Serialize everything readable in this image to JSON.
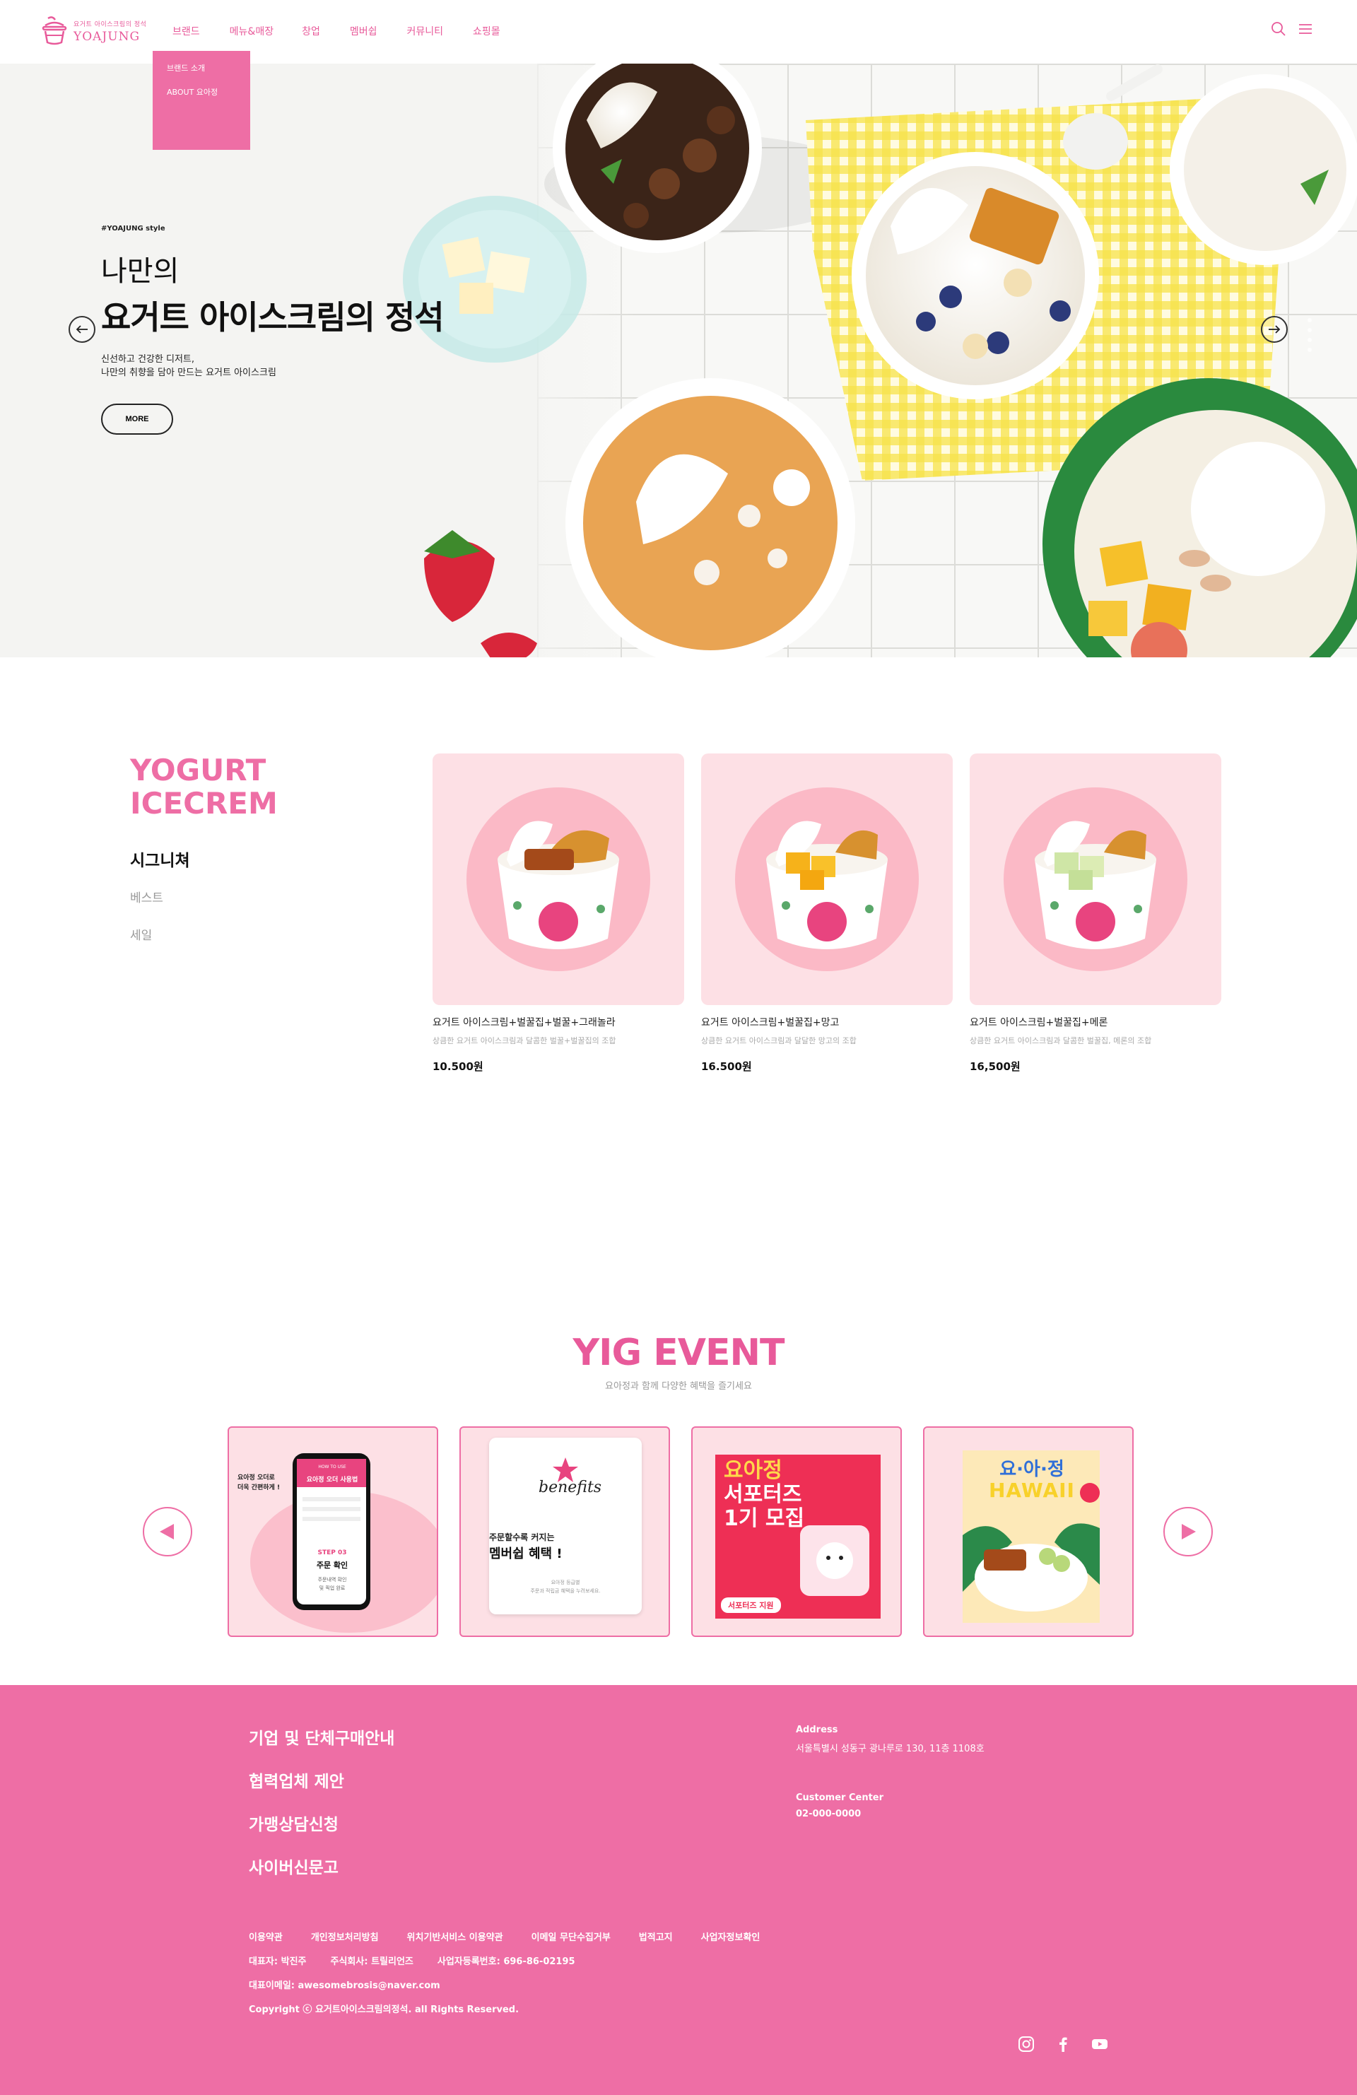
{
  "brand": {
    "tagline": "요거트 아이스크림의 정석",
    "name": "YOAJUNG",
    "accent_color": "#ee6ea5"
  },
  "nav": {
    "items": [
      "브랜드",
      "메뉴&매장",
      "창업",
      "멤버쉽",
      "커뮤니티",
      "쇼핑몰"
    ],
    "dropdown": [
      "브랜드 소개",
      "ABOUT 요아정"
    ]
  },
  "hero": {
    "tag": "#YOAJUNG style",
    "title_line1": "나만의",
    "title_line2": "요거트 아이스크림의 정석",
    "desc_line1": "신선하고 건강한 디저트,",
    "desc_line2": "나만의 취향을 담아 만드는 요거트 아이스크림",
    "more_label": "MORE",
    "prev_icon": "arrow-left-icon",
    "next_icon": "arrow-right-icon"
  },
  "yogurt": {
    "title_line1": "YOGURT",
    "title_line2": "ICECREM",
    "tabs": [
      "시그니쳐",
      "베스트",
      "세일"
    ],
    "products": [
      {
        "name": "요거트 아이스크림+벌꿀집+벌꿀+그래놀라",
        "desc": "상큼한 요거트 아이스크림과 달콤한 벌꿀+벌꿀집의 조합",
        "price": "10.500원"
      },
      {
        "name": "요거트 아이스크림+벌꿀집+망고",
        "desc": "상큼한 요거트 아이스크림과 달달한 망고의 조합",
        "price": "16.500원"
      },
      {
        "name": "요거트 아이스크림+벌꿀집+메론",
        "desc": "상큼한 요거트 아이스크림과 달콤한 벌꿀집, 메론의 조합",
        "price": "16,500원"
      }
    ]
  },
  "event": {
    "title": "YIG EVENT",
    "subtitle": "요아정과 함께 다양한 혜택을 즐기세요",
    "cards": [
      {
        "phone_header_top": "HOW TO USE",
        "phone_header": "요아정 오더 사용법",
        "phone_step": "STEP 03",
        "phone_step_title": "주문 확인",
        "phone_step_desc1": "주문내역 확인",
        "phone_step_desc2": "및 픽업 완료",
        "caption_line1": "요아정 오더로",
        "caption_line2": "더욱 간편하게 !"
      },
      {
        "script": "benefits",
        "line1": "주문할수록 커지는",
        "line2": "멤버쉽 혜택 !",
        "small1": "요아정 등급별",
        "small2": "주문과 적립금 혜택을 누려보세요."
      },
      {
        "line1": "요아정",
        "line2": "서포터즈",
        "line3": "1기 모집",
        "badge": "서포터즈 지원"
      },
      {
        "line1": "요·아·정",
        "line2": "HAWAII"
      }
    ]
  },
  "footer": {
    "links": [
      "기업 및 단체구매안내",
      "협력업체 제안",
      "가맹상담신청",
      "사이버신문고"
    ],
    "address_label": "Address",
    "address": "서울특별시 성동구 광나루로 130, 11층 1108호",
    "cs_label": "Customer Center",
    "cs_phone": "02-000-0000",
    "policies": [
      "이용약관",
      "개인정보처리방침",
      "위치기반서비스 이용약관",
      "이메일 무단수집거부",
      "법적고지",
      "사업자정보확인"
    ],
    "ceo": "대표자: 박진주",
    "company": "주식회사: 트릴리언즈",
    "biz_no": "사업자등록번호: 696-86-02195",
    "email": "대표이메일: awesomebrosis@naver.com",
    "copyright": "Copyright ⓒ 요거트아이스크림의정석. all Rights Reserved.",
    "social_icons": [
      "instagram-icon",
      "facebook-icon",
      "youtube-icon"
    ]
  }
}
